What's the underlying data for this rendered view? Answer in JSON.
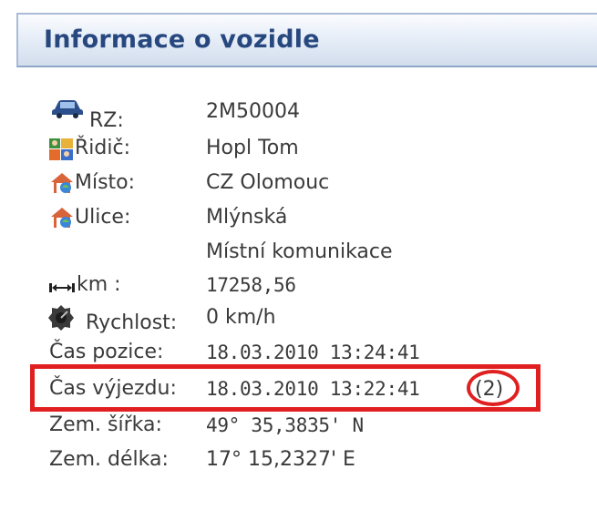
{
  "panel": {
    "title": "Informace o vozidle",
    "rows": [
      {
        "label": "RZ:",
        "value": "2M50004",
        "icon": "car-icon"
      },
      {
        "label": "Řidič:",
        "value": "Hopl Tom",
        "icon": "driver-icon"
      },
      {
        "label": "Místo:",
        "value": "CZ Olomouc",
        "icon": "location-icon"
      },
      {
        "label": "Ulice:",
        "value": "Mlýnská",
        "icon": "street-icon"
      },
      {
        "label": "",
        "value": "Místní komunikace"
      },
      {
        "label": "km :",
        "value": "17258,56",
        "icon": "distance-icon"
      },
      {
        "label": "Rychlost:",
        "value": "0 km/h",
        "icon": "speed-icon"
      },
      {
        "label": "Čas pozice:",
        "value": "18.03.2010 13:24:41"
      },
      {
        "label": "Čas výjezdu:",
        "value": "18.03.2010 13:22:41",
        "counter": "(2)"
      },
      {
        "label": "Zem. šířka:",
        "value": "49° 35,3835' N"
      },
      {
        "label": "Zem. délka:",
        "value": "17° 15,2327' E"
      }
    ]
  },
  "colors": {
    "title": "#27477f",
    "highlight": "#e02020",
    "text": "#3a3a3a"
  }
}
